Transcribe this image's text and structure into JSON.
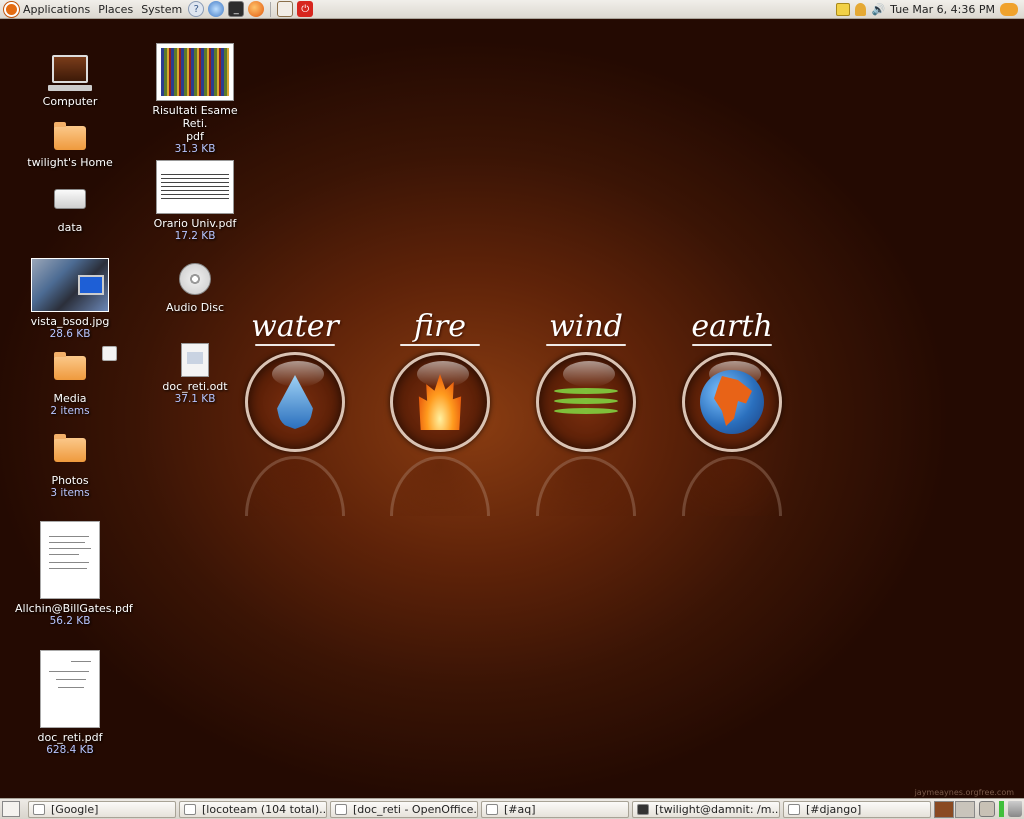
{
  "top_panel": {
    "menus": [
      "Applications",
      "Places",
      "System"
    ],
    "launchers": [
      "help-icon",
      "browser-icon",
      "terminal-icon",
      "firefox-icon",
      "presentation-icon",
      "power-icon"
    ],
    "clock": "Tue Mar  6,  4:36 PM"
  },
  "desktop_icons": {
    "computer": {
      "label": "Computer"
    },
    "home": {
      "label": "twilight's Home"
    },
    "data": {
      "label": "data"
    },
    "vista": {
      "label": "vista_bsod.jpg",
      "meta": "28.6 KB"
    },
    "media": {
      "label": "Media",
      "meta": "2 items"
    },
    "photos": {
      "label": "Photos",
      "meta": "3 items"
    },
    "allchin": {
      "label": "Allchin@BillGates.pdf",
      "meta": "56.2 KB"
    },
    "docpdf": {
      "label": "doc_reti.pdf",
      "meta": "628.4 KB"
    },
    "risultati": {
      "label": "Risultati Esame Reti.\npdf",
      "meta": "31.3 KB"
    },
    "orario": {
      "label": "Orario Univ.pdf",
      "meta": "17.2 KB"
    },
    "audio": {
      "label": "Audio Disc"
    },
    "docodt": {
      "label": "doc_reti.odt",
      "meta": "37.1 KB"
    }
  },
  "wallpaper": {
    "elements": [
      "water",
      "fire",
      "wind",
      "earth"
    ],
    "credit": "jaymeaynes.orgfree.com"
  },
  "taskbar": {
    "tasks": [
      "[Google]",
      "[locoteam (104 total)...",
      "[doc_reti - OpenOffice...",
      "[#aq]",
      "[twilight@damnit: /m...",
      "[#django]"
    ]
  },
  "colors": {
    "accent": "#e46c12",
    "file_meta": "#b8c6ff"
  }
}
